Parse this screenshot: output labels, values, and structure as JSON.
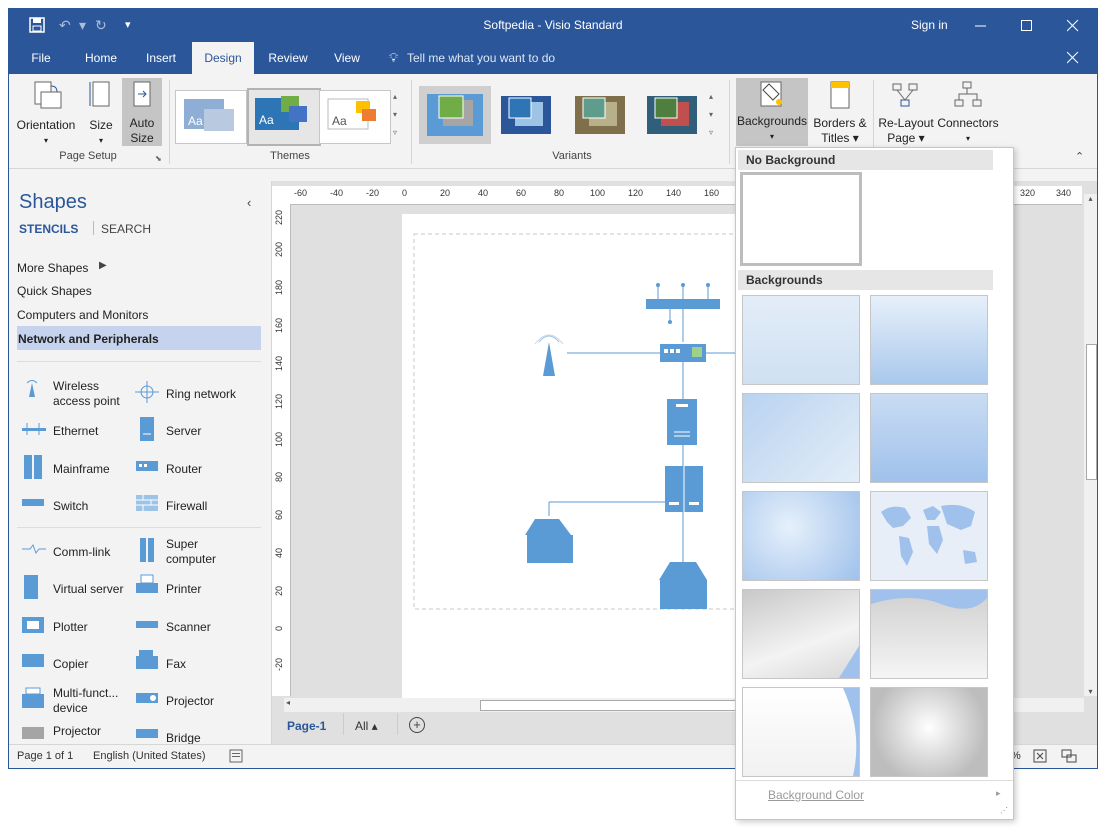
{
  "window": {
    "title": "Softpedia - Visio Standard",
    "sign_in": "Sign in"
  },
  "tabs": [
    "File",
    "Home",
    "Insert",
    "Design",
    "Review",
    "View"
  ],
  "tell_me": "Tell me what you want to do",
  "ribbon": {
    "orientation": "Orientation",
    "size": "Size",
    "auto": "Auto",
    "size2": "Size",
    "page_setup": "Page Setup",
    "themes": "Themes",
    "variants": "Variants",
    "backgrounds": "Backgrounds",
    "borders": "Borders &",
    "titles": "Titles",
    "relayout": "Re-Layout",
    "page": "Page",
    "connectors": "Connectors",
    "theme_aa": "Aa"
  },
  "shapes": {
    "title": "Shapes",
    "stencils": "STENCILS",
    "search": "SEARCH",
    "more_shapes": "More Shapes",
    "quick_shapes": "Quick Shapes",
    "computers": "Computers and Monitors",
    "network": "Network and Peripherals",
    "items": [
      {
        "a": "Wireless",
        "b": "access point"
      },
      {
        "a": "Ring network"
      },
      {
        "a": "Ethernet"
      },
      {
        "a": "Server"
      },
      {
        "a": "Mainframe"
      },
      {
        "a": "Router"
      },
      {
        "a": "Switch"
      },
      {
        "a": "Firewall"
      },
      {
        "a": "Comm-link"
      },
      {
        "a": "Super",
        "b": "computer"
      },
      {
        "a": "Virtual server"
      },
      {
        "a": "Printer"
      },
      {
        "a": "Plotter"
      },
      {
        "a": "Scanner"
      },
      {
        "a": "Copier"
      },
      {
        "a": "Fax"
      },
      {
        "a": "Multi-funct...",
        "b": "device"
      },
      {
        "a": "Projector"
      },
      {
        "a": "Projector"
      },
      {
        "a": "Bridge"
      }
    ]
  },
  "ruler_h": [
    "-60",
    "-40",
    "-20",
    "0",
    "20",
    "40",
    "60",
    "80",
    "100",
    "120",
    "140",
    "160",
    "320",
    "340"
  ],
  "ruler_v": [
    "220",
    "200",
    "180",
    "160",
    "140",
    "120",
    "100",
    "80",
    "60",
    "40",
    "20",
    "0",
    "-20"
  ],
  "page_tabs": {
    "page1": "Page-1",
    "all": "All"
  },
  "status": {
    "page": "Page 1 of 1",
    "lang": "English (United States)",
    "zoom_partial": "%"
  },
  "dropdown": {
    "no_background": "No Background",
    "backgrounds": "Backgrounds",
    "background_color": "Background Color"
  },
  "colors": {
    "accent": "#2b579a",
    "shape_blue": "#5b9bd5"
  }
}
